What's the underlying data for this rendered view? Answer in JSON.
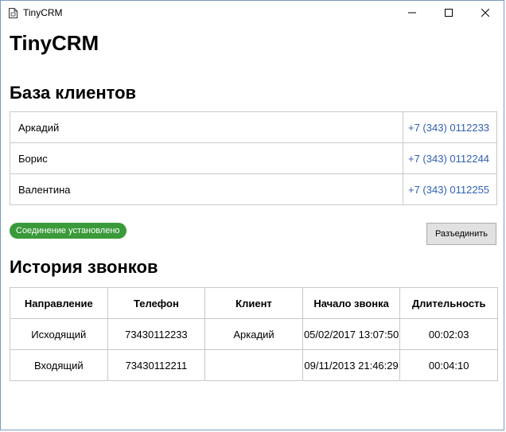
{
  "window": {
    "title": "TinyCRM",
    "controls": {
      "minimize": "minimize-icon",
      "maximize": "maximize-icon",
      "close": "close-icon"
    }
  },
  "app_title": "TinyCRM",
  "clients_section": {
    "title": "База клиентов",
    "rows": [
      {
        "name": "Аркадий",
        "phone": "+7 (343) 0112233"
      },
      {
        "name": "Борис",
        "phone": "+7 (343) 0112244"
      },
      {
        "name": "Валентина",
        "phone": "+7 (343) 0112255"
      }
    ]
  },
  "status": {
    "text": "Соединение установлено",
    "color": "#3a9a3a"
  },
  "disconnect_button": "Разъединить",
  "history_section": {
    "title": "История звонков",
    "headers": [
      "Направление",
      "Телефон",
      "Клиент",
      "Начало звонка",
      "Длительность"
    ],
    "rows": [
      [
        "Исходящий",
        "73430112233",
        "Аркадий",
        "05/02/2017 13:07:50",
        "00:02:03"
      ],
      [
        "Входящий",
        "73430112211",
        "",
        "09/11/2013 21:46:29",
        "00:04:10"
      ]
    ]
  },
  "colors": {
    "link": "#2f5fb3",
    "border": "#c8c8c8",
    "button_bg": "#e1e1e1"
  }
}
